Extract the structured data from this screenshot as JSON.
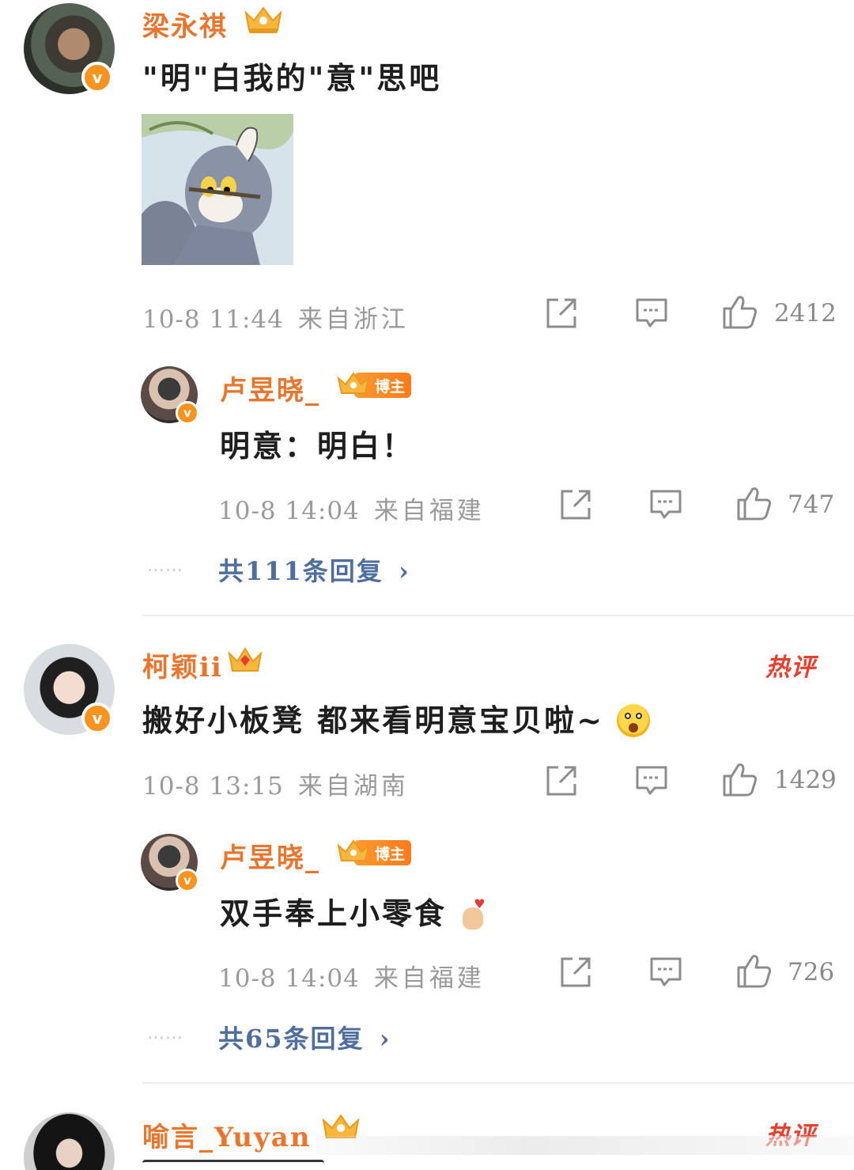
{
  "colors": {
    "name": "#e8762f",
    "reply_link": "#4f6e9c",
    "hot": "#e8402e",
    "meta": "#9a9a9a"
  },
  "comments": [
    {
      "user": "梁永祺",
      "text": "\"明\"白我的\"意\"思吧",
      "has_image": true,
      "image_icon": "tom-cat-sticker",
      "time": "10-8 11:44",
      "location": "来自浙江",
      "likes": "2412",
      "reply": {
        "user": "卢昱晓_",
        "badge": "博主",
        "text": "明意：明白！",
        "time": "10-8 14:04",
        "location": "来自福建",
        "likes": "747"
      },
      "replies_label": "共111条回复",
      "dots": "……"
    },
    {
      "user": "柯颖ii",
      "hot_label": "热评",
      "text": "搬好小板凳 都来看明意宝贝啦~",
      "emoji_icon": "excited-face-emoji",
      "time": "10-8 13:15",
      "location": "来自湖南",
      "likes": "1429",
      "reply": {
        "user": "卢昱晓_",
        "badge": "博主",
        "text": "双手奉上小零食",
        "emoji_icon": "finger-heart-emoji",
        "time": "10-8 14:04",
        "location": "来自福建",
        "likes": "726"
      },
      "replies_label": "共65条回复",
      "dots": "……"
    },
    {
      "user": "喻言_Yuyan",
      "hot_label": "热评"
    }
  ]
}
